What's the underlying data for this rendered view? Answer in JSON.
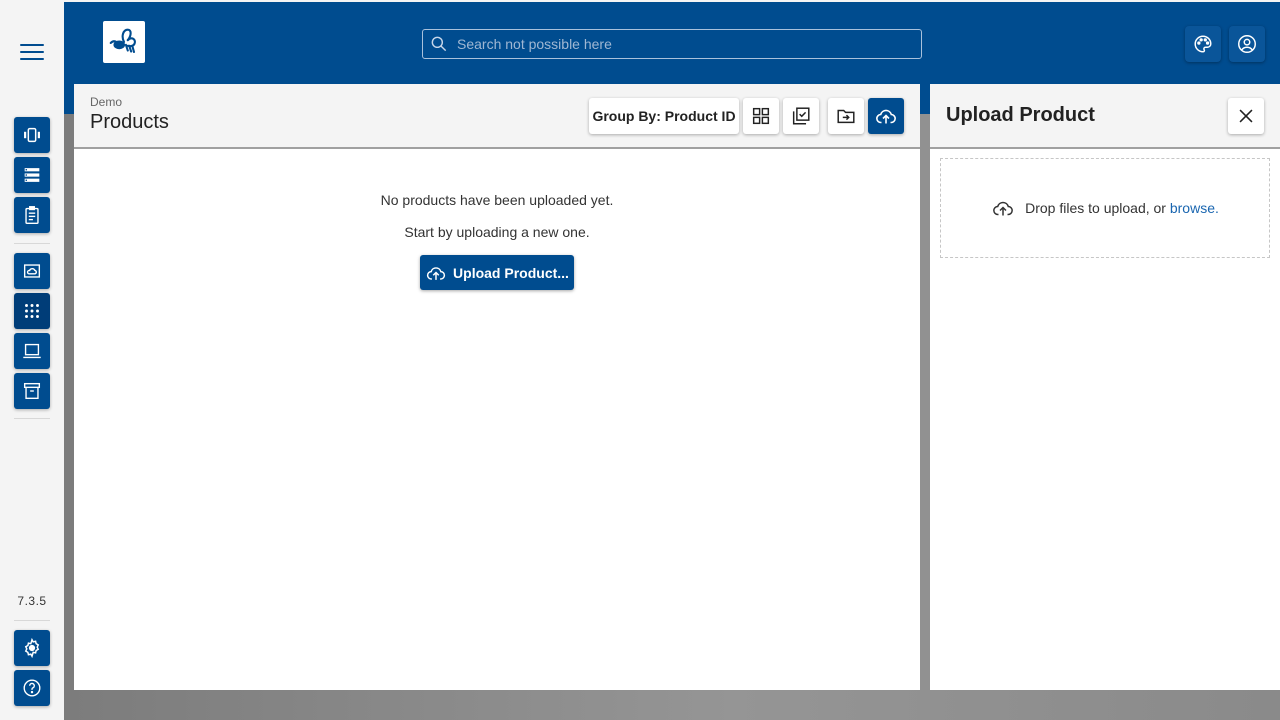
{
  "app": {
    "version": "7.3.5",
    "logo_icon": "bee-logo-icon",
    "brand_color": "#004c8f"
  },
  "rail": {
    "menu_icon": "hamburger-icon",
    "group1": [
      {
        "name": "devices",
        "icon": "vibrate-device-icon",
        "active": false
      },
      {
        "name": "list",
        "icon": "server-list-icon",
        "active": false
      },
      {
        "name": "tasks",
        "icon": "clipboard-icon",
        "active": false
      }
    ],
    "group2": [
      {
        "name": "cloud",
        "icon": "cloud-image-icon",
        "active": false
      },
      {
        "name": "products",
        "icon": "dots-grid-icon",
        "active": true
      },
      {
        "name": "laptop",
        "icon": "laptop-icon",
        "active": false
      },
      {
        "name": "archive",
        "icon": "archive-icon",
        "active": false
      }
    ],
    "bottom": [
      {
        "name": "settings",
        "icon": "gear-icon"
      },
      {
        "name": "help",
        "icon": "help-icon"
      }
    ]
  },
  "topbar": {
    "search_placeholder": "Search not possible here",
    "search_value": "",
    "theme_icon": "palette-icon",
    "account_icon": "account-icon"
  },
  "main": {
    "breadcrumb": "Demo",
    "title": "Products",
    "toolbar": {
      "group_by_label": "Group By: Product ID",
      "grid_icon": "grid-view-icon",
      "select_icon": "multi-select-icon",
      "move_icon": "folder-move-icon",
      "upload_icon": "cloud-upload-icon"
    },
    "empty_line1": "No products have been uploaded yet.",
    "empty_line2": "Start by uploading a new one.",
    "upload_button_label": "Upload Product..."
  },
  "side_panel": {
    "title": "Upload Product",
    "close_icon": "close-icon",
    "dropzone_text": "Drop files to upload, or ",
    "browse_label": "browse."
  }
}
